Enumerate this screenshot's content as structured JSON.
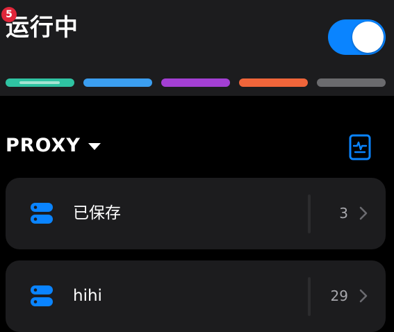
{
  "status": {
    "badge_count": "5",
    "title": "运行中",
    "toggle_on": true
  },
  "color_bars": [
    {
      "name": "teal",
      "color": "#2fc3a2"
    },
    {
      "name": "blue",
      "color": "#3b9ef0"
    },
    {
      "name": "purple",
      "color": "#a33fd4"
    },
    {
      "name": "orange",
      "color": "#f0653a"
    },
    {
      "name": "gray",
      "color": "#6b6b6e"
    }
  ],
  "section": {
    "title": "PROXY",
    "dropdown_icon": "caret-down-icon",
    "action_icon": "document-pulse-icon"
  },
  "cards": [
    {
      "label": "已保存",
      "count": "3",
      "icon": "server-icon"
    },
    {
      "label": "hihi",
      "count": "29",
      "icon": "server-icon"
    }
  ],
  "colors": {
    "accent": "#0a84ff",
    "badge": "#e0263a",
    "card_bg": "#1c1c1e",
    "page_bg": "#000000"
  }
}
